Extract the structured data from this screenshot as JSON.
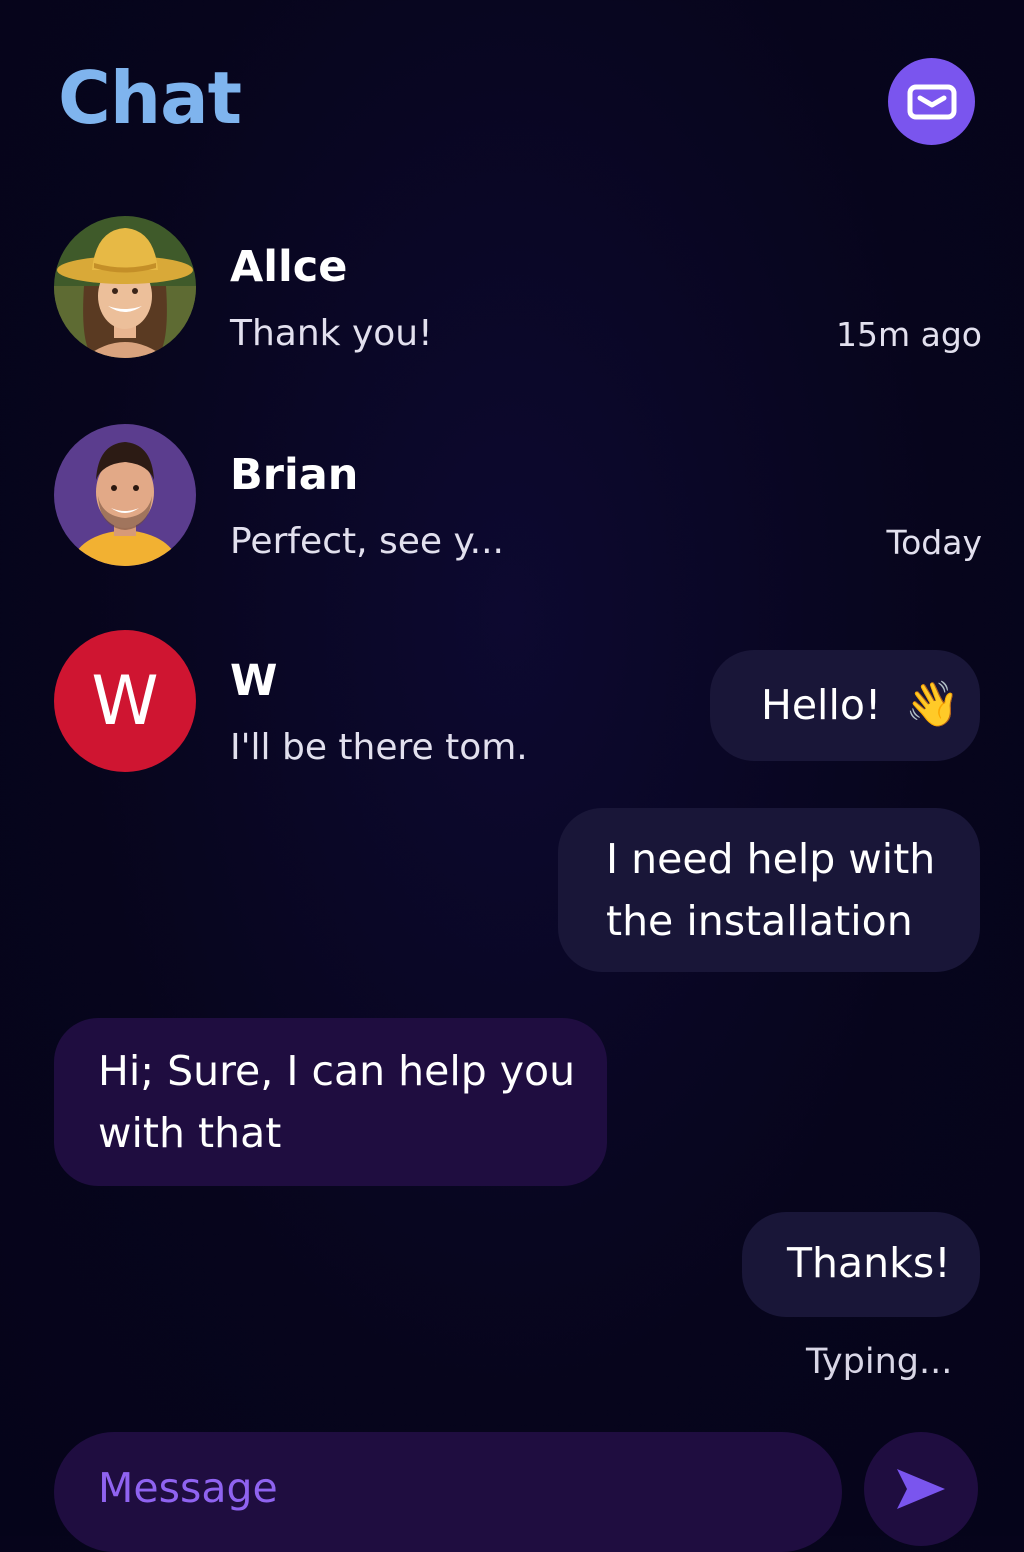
{
  "header": {
    "title": "Chat",
    "compose_icon": "mail-icon",
    "accent_color": "#7a55ee",
    "title_color": "#7fb4ee"
  },
  "conversations": [
    {
      "name": "Allce",
      "preview": "Thank you!",
      "time": "15m ago",
      "avatar": "photo-woman-yellow-hat"
    },
    {
      "name": "Brian",
      "preview": "Perfect, see y...",
      "time": "Today",
      "avatar": "photo-man-smiling"
    },
    {
      "name": "W",
      "preview": "I'll be there tom.",
      "avatar_letter": "W",
      "avatar_color": "#cf1531"
    }
  ],
  "messages": [
    {
      "direction": "outgoing",
      "text": "Hello!",
      "emoji": "👋"
    },
    {
      "direction": "outgoing",
      "lines": [
        "I need help with",
        "the installation"
      ]
    },
    {
      "direction": "incoming",
      "lines": [
        "Hi; Sure, I can help you",
        "with that"
      ]
    },
    {
      "direction": "outgoing",
      "text": "Thanks!"
    }
  ],
  "status": {
    "typing": "Typing..."
  },
  "composer": {
    "placeholder": "Message",
    "value": "",
    "send_icon": "send-icon"
  }
}
